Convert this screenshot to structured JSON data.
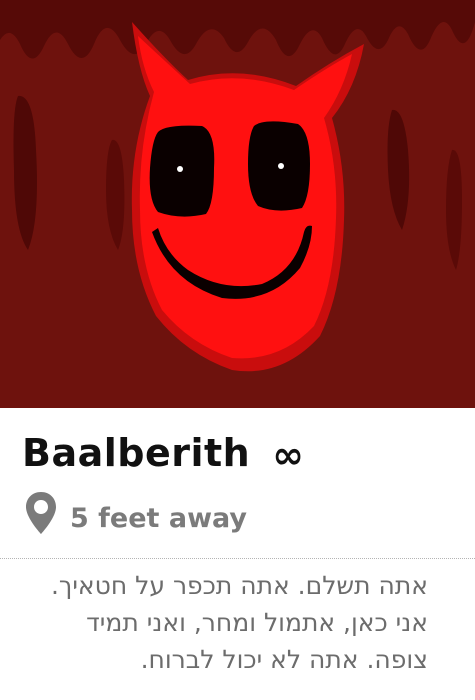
{
  "profile": {
    "name": "Baalberith",
    "age": "∞",
    "distance": "5 feet away",
    "bio": "אתה תשלם. אתה תכפר על חטאיך. אני כאן, אתמול ומחר, ואני תמיד צופה. אתה לא יכול לברוח."
  },
  "icons": {
    "location": "map-pin-icon"
  },
  "colors": {
    "photo_background": "#6e120d",
    "devil_red": "#ff1010",
    "name_text": "#111111",
    "secondary_text": "#7b7b7b"
  }
}
